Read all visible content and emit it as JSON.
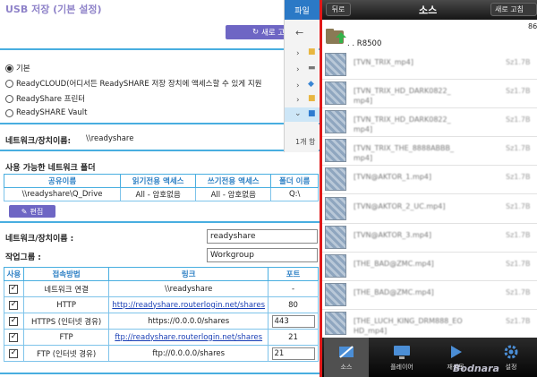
{
  "left": {
    "title": "USB 저장 (기본 설정)",
    "refresh_label": "새로 고침",
    "radio_options": [
      {
        "label": "기본",
        "selected": true
      },
      {
        "label": "ReadyCLOUD(어디서든 ReadySHARE 저장 장치에 액세스할 수 있게 지원",
        "selected": false
      },
      {
        "label": "ReadyShare 프린터",
        "selected": false
      },
      {
        "label": "ReadySHARE Vault",
        "selected": false
      }
    ],
    "network_device_label": "네트워크/장치이름:",
    "network_device_value": "\\\\readyshare",
    "shares_header": "사용 가능한 네트워크 폴더",
    "share_table": {
      "headers": [
        "공유이름",
        "읽기전용 액세스",
        "쓰기전용 액세스",
        "폴더 이름"
      ],
      "rows": [
        [
          "\\\\readyshare\\Q_Drive",
          "All - 암호없음",
          "All - 암호없음",
          "Q:\\"
        ]
      ]
    },
    "edit_label": "편집",
    "device_name_label": "네트워크/장치이름 :",
    "device_name_value": "readyshare",
    "workgroup_label": "작업그룹 :",
    "workgroup_value": "Workgroup",
    "access_table": {
      "headers": [
        "사용",
        "접속방법",
        "링크",
        "포트"
      ],
      "rows": [
        {
          "checked": true,
          "method": "네트워크 연결",
          "link": "\\\\readyshare",
          "is_link": false,
          "port": "-",
          "port_editable": false
        },
        {
          "checked": true,
          "method": "HTTP",
          "link": "http://readyshare.routerlogin.net/shares",
          "is_link": true,
          "port": "80",
          "port_editable": false
        },
        {
          "checked": true,
          "method": "HTTPS (인터넷 경유)",
          "link": "https://0.0.0.0/shares",
          "is_link": false,
          "port": "443",
          "port_editable": true
        },
        {
          "checked": true,
          "method": "FTP",
          "link": "ftp://readyshare.routerlogin.net/shares",
          "is_link": true,
          "port": "21",
          "port_editable": false
        },
        {
          "checked": true,
          "method": "FTP (인터넷 경유)",
          "link": "ftp://0.0.0.0/shares",
          "is_link": false,
          "port": "21",
          "port_editable": true
        }
      ]
    },
    "accent_color": "#48aee0",
    "button_color": "#6e66c4"
  },
  "explorer": {
    "tab_label": "파일",
    "count_label": "1개 항"
  },
  "phone": {
    "back_label": "뒤로",
    "title": "소스",
    "new_label": "새로 고침",
    "page_num": "86",
    "folder_name": ". . R8500",
    "files": [
      {
        "name": "[TVN_TRIX_mp4]",
        "name2": "",
        "size": "Sz1.7B"
      },
      {
        "name": "[TVN_TRIX_HD_DARK0822_",
        "name2": "mp4]",
        "size": "Sz1.7B"
      },
      {
        "name": "[TVN_TRIX_HD_DARK0822_",
        "name2": "mp4]",
        "size": "Sz1.7B"
      },
      {
        "name": "[TVN_TRIX_THE_8888ABBB_",
        "name2": "mp4]",
        "size": "Sz1.7B"
      },
      {
        "name": "[TVN@AKTOR_1.mp4]",
        "name2": "",
        "size": "Sz1.7B"
      },
      {
        "name": "[TVN@AKTOR_2_UC.mp4]",
        "name2": "",
        "size": "Sz1.7B"
      },
      {
        "name": "[TVN@AKTOR_3.mp4]",
        "name2": "",
        "size": "Sz1.7B"
      },
      {
        "name": "[THE_BAD@ZMC.mp4]",
        "name2": "",
        "size": "Sz1.7B"
      },
      {
        "name": "[THE_BAD@ZMC.mp4]",
        "name2": "",
        "size": "Sz1.7B"
      },
      {
        "name": "[THE_LUCH_KING_DRM888_EO",
        "name2": "HD_mp4]",
        "size": "Sz1.7B"
      }
    ],
    "tabs": [
      {
        "label": "소스",
        "icon": "source-icon",
        "active": true
      },
      {
        "label": "플레이어",
        "icon": "player-icon",
        "active": false
      },
      {
        "label": "재생목",
        "icon": "play-icon",
        "active": false
      },
      {
        "label": "설정",
        "icon": "gear-icon",
        "active": false
      }
    ],
    "watermark": "Bodnara"
  }
}
